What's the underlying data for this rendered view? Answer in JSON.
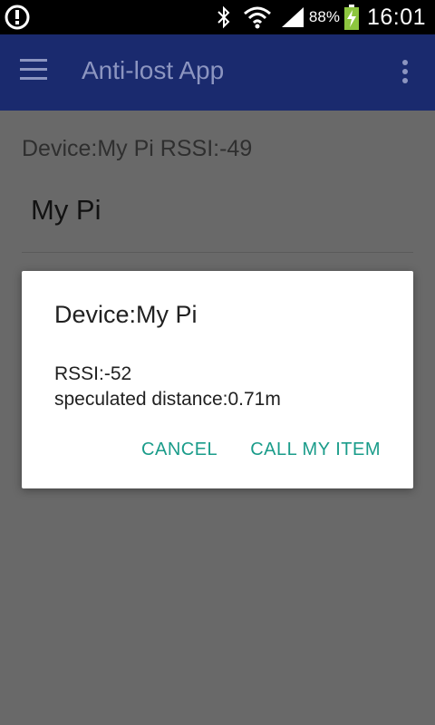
{
  "status_bar": {
    "battery_percent": "88%",
    "time": "16:01",
    "icons": [
      "alert-icon",
      "bluetooth-icon",
      "wifi-icon",
      "signal-icon",
      "battery-charging-icon"
    ]
  },
  "app_bar": {
    "title": "Anti-lost App",
    "icons": [
      "hamburger-menu-icon",
      "overflow-menu-icon"
    ]
  },
  "main": {
    "device_header": "Device:My Pi RSSI:-49",
    "device_name": "My Pi"
  },
  "dialog": {
    "title": "Device:My Pi",
    "rssi": "RSSI:-52",
    "distance": "speculated distance:0.71m",
    "cancel_label": "CANCEL",
    "call_label": "CALL MY ITEM"
  },
  "colors": {
    "app_bar": "#1a2a6e",
    "accent": "#1a9c8a",
    "scrim": "#696969"
  }
}
